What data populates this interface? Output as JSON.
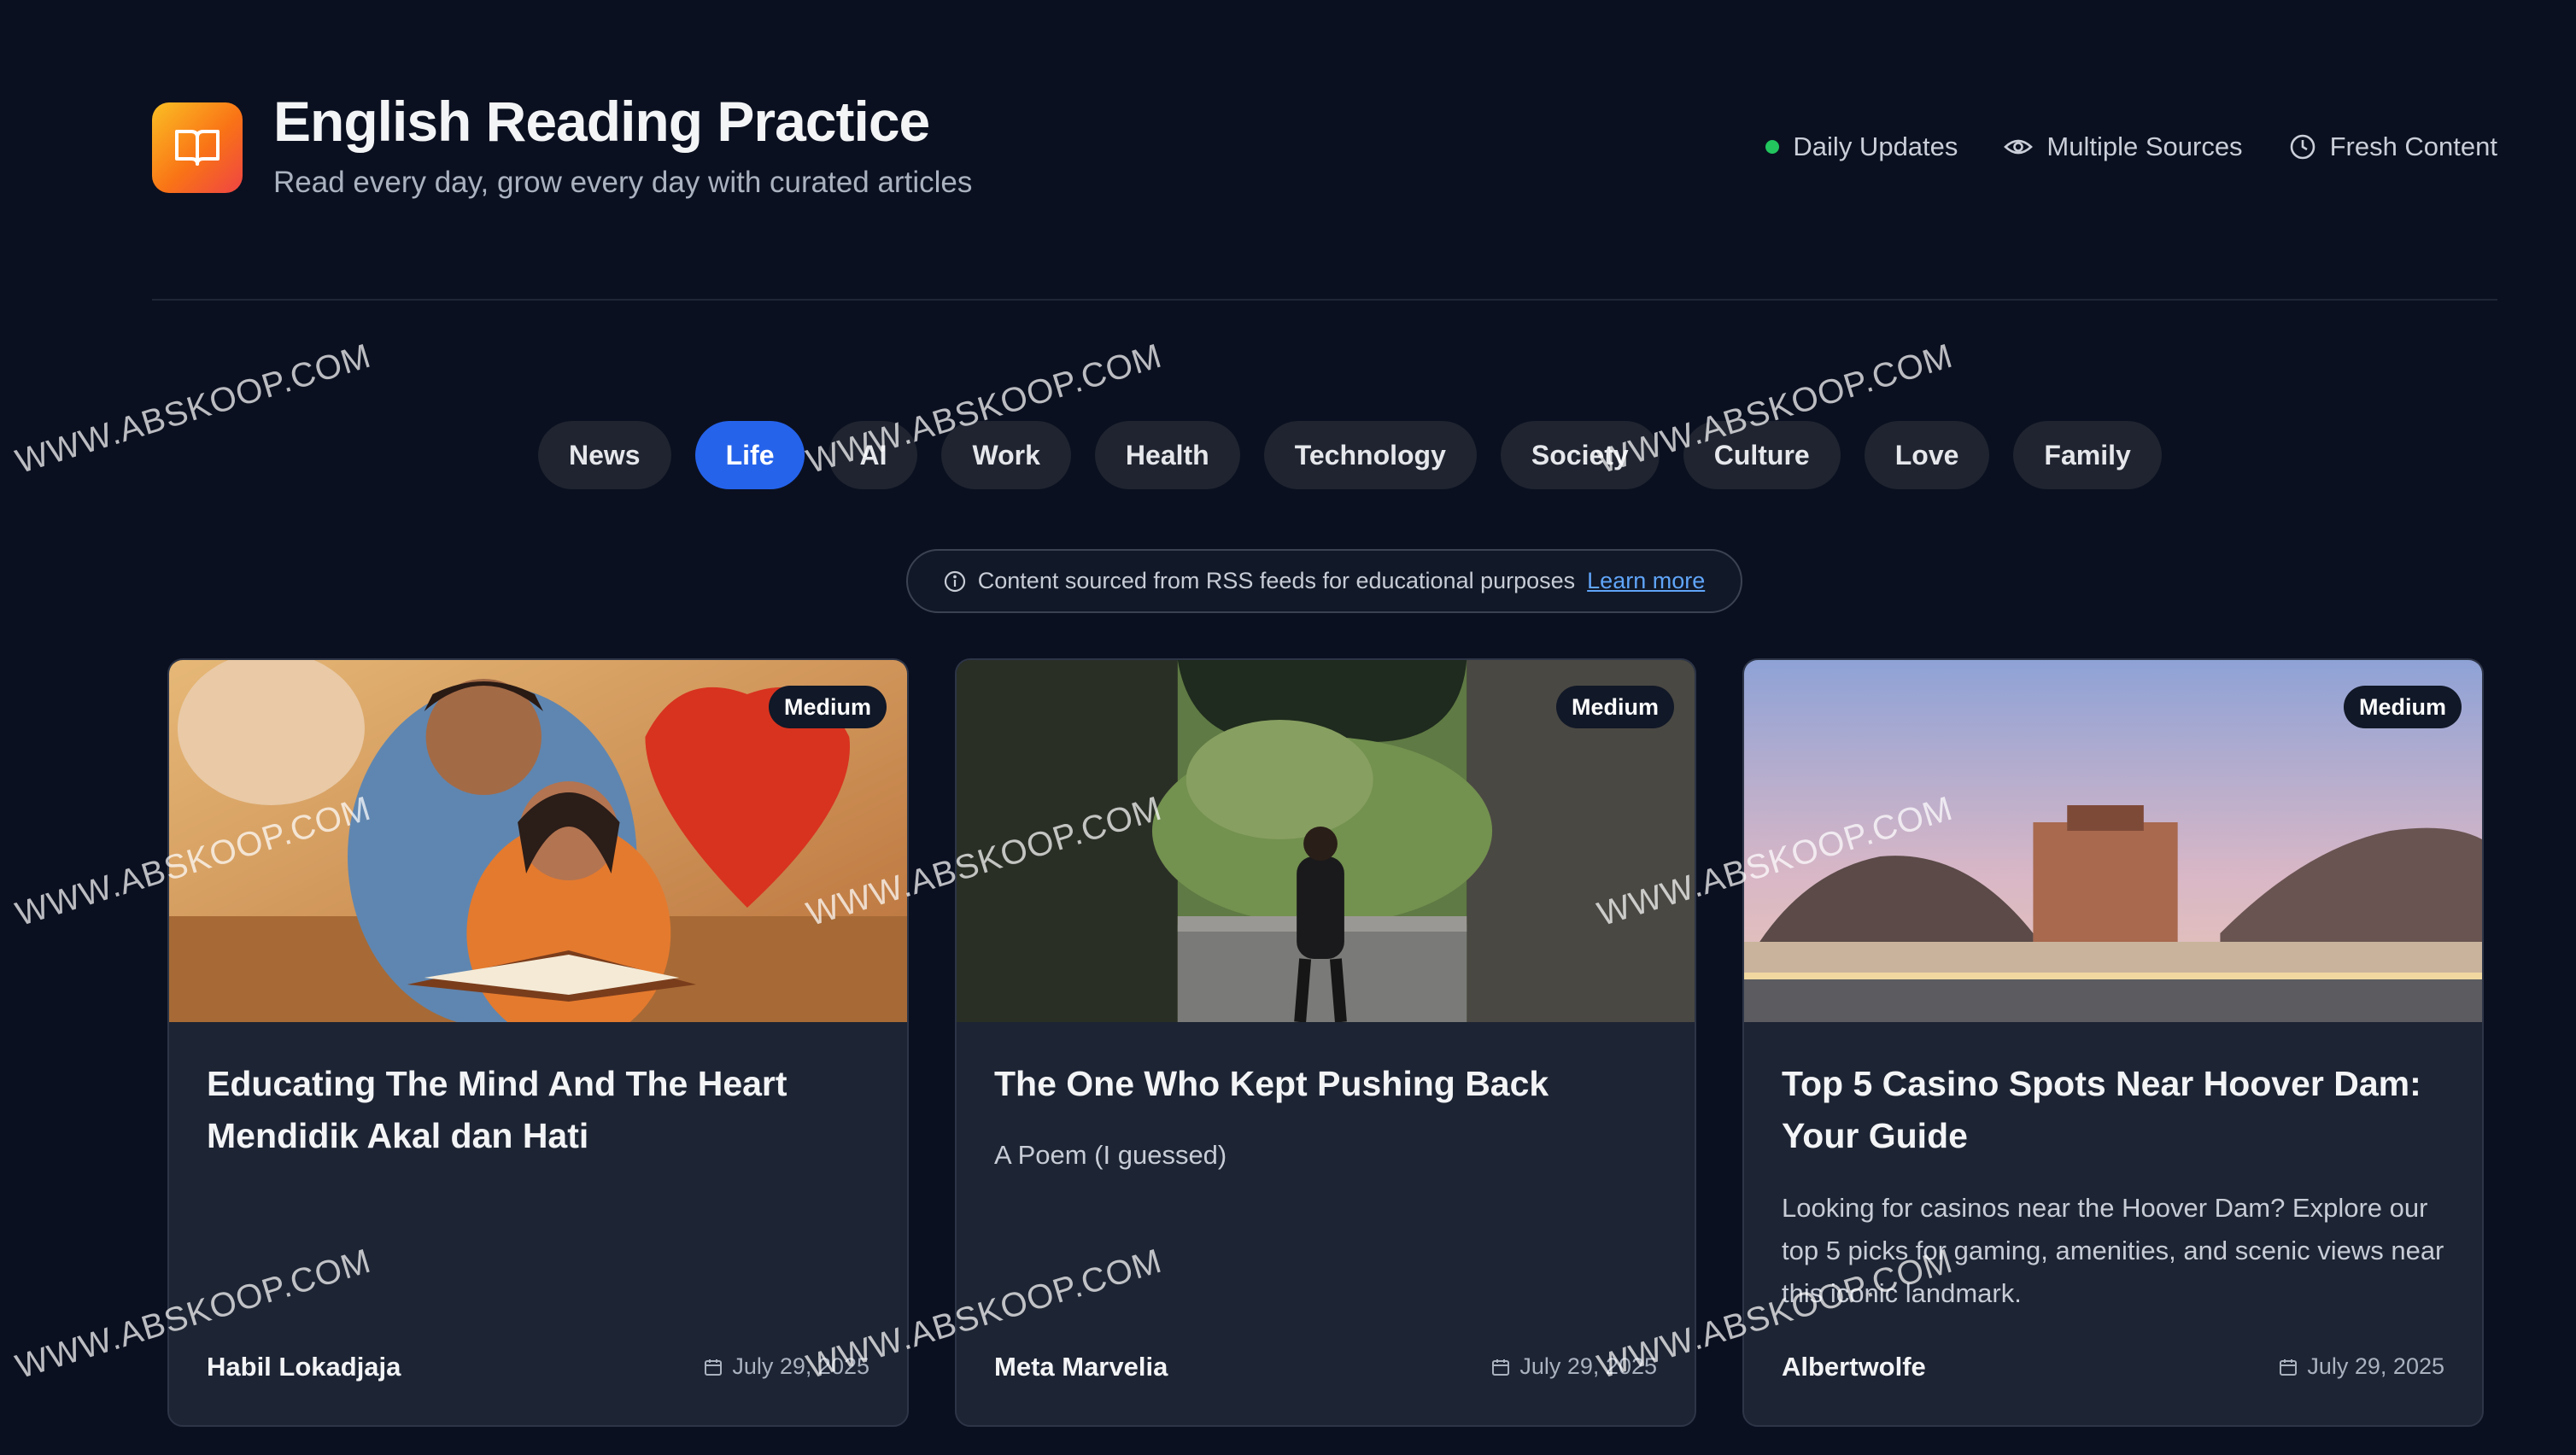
{
  "header": {
    "title": "English Reading Practice",
    "subtitle": "Read every day, grow every day with curated articles",
    "badges": [
      {
        "label": "Daily Updates",
        "icon": "status-dot",
        "color": "#22c55e"
      },
      {
        "label": "Multiple Sources",
        "icon": "eye-icon"
      },
      {
        "label": "Fresh Content",
        "icon": "clock-icon"
      }
    ],
    "logo_icon": "open-book-icon"
  },
  "tabs": [
    {
      "label": "News",
      "active": false
    },
    {
      "label": "Life",
      "active": true
    },
    {
      "label": "AI",
      "active": false
    },
    {
      "label": "Work",
      "active": false
    },
    {
      "label": "Health",
      "active": false
    },
    {
      "label": "Technology",
      "active": false
    },
    {
      "label": "Society",
      "active": false
    },
    {
      "label": "Culture",
      "active": false
    },
    {
      "label": "Love",
      "active": false
    },
    {
      "label": "Family",
      "active": false
    }
  ],
  "info": {
    "text": "Content sourced from RSS feeds for educational purposes",
    "link": "Learn more",
    "icon": "info-icon"
  },
  "cards": [
    {
      "level": "Medium",
      "title": "Educating The Mind And The Heart Mendidik Akal dan Hati",
      "description": "",
      "author": "Habil Lokadjaja",
      "date": "July 29, 2025"
    },
    {
      "level": "Medium",
      "title": "The One Who Kept Pushing Back",
      "description": "A Poem (I guessed)",
      "author": "Meta Marvelia",
      "date": "July 29, 2025"
    },
    {
      "level": "Medium",
      "title": "Top 5 Casino Spots Near Hoover Dam: Your Guide",
      "description": "Looking for casinos near the Hoover Dam? Explore our top 5 picks for gaming, amenities, and scenic views near this iconic landmark.",
      "author": "Albertwolfe",
      "date": "July 29, 2025"
    }
  ],
  "watermark": "WWW.ABSKOOP.COM",
  "colors": {
    "background": "#0b1020",
    "accent": "#2563eb",
    "card": "#1d2433",
    "link": "#60a5fa"
  }
}
